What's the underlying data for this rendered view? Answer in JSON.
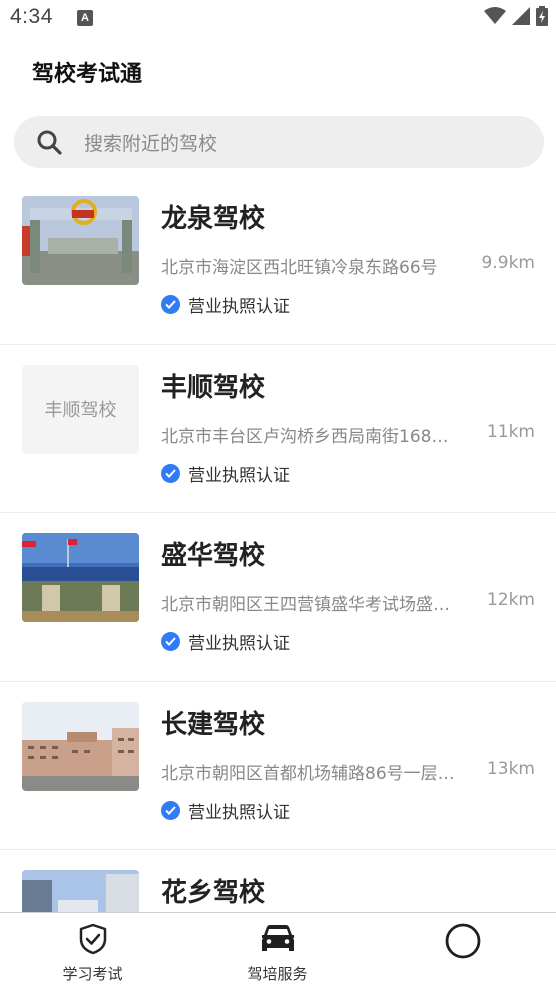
{
  "status_bar": {
    "time": "4:34"
  },
  "app": {
    "title": "驾校考试通"
  },
  "search": {
    "placeholder": "搜索附近的驾校"
  },
  "schools": [
    {
      "name": "龙泉驾校",
      "address": "北京市海淀区西北旺镇冷泉东路66号",
      "distance": "9.9km",
      "badge": "营业执照认证",
      "thumb": "photo"
    },
    {
      "name": "丰顺驾校",
      "address": "北京市丰台区卢沟桥乡西局南街168…",
      "distance": "11km",
      "badge": "营业执照认证",
      "thumb": "placeholder",
      "thumb_text": "丰顺驾校"
    },
    {
      "name": "盛华驾校",
      "address": "北京市朝阳区王四营镇盛华考试场盛…",
      "distance": "12km",
      "badge": "营业执照认证",
      "thumb": "photo"
    },
    {
      "name": "长建驾校",
      "address": "北京市朝阳区首都机场辅路86号一层…",
      "distance": "13km",
      "badge": "营业执照认证",
      "thumb": "photo"
    },
    {
      "name": "花乡驾校",
      "thumb": "photo"
    }
  ],
  "tabs": [
    {
      "label": "学习考试",
      "icon": "shield-check-icon"
    },
    {
      "label": "驾培服务",
      "icon": "car-icon",
      "active": true
    },
    {
      "label": "",
      "icon": "circle-icon"
    }
  ],
  "colors": {
    "accent": "#2f7cf6",
    "search_bg": "#eeeeee",
    "muted_text": "#888888"
  }
}
